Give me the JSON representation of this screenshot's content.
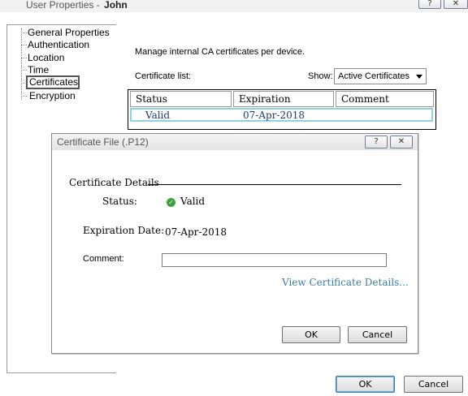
{
  "window": {
    "title_prefix": "User Properties -",
    "title_user": "John",
    "help_button": "?",
    "close_button": "✕"
  },
  "sidebar": {
    "items": [
      {
        "label": "General Properties"
      },
      {
        "label": "Authentication"
      },
      {
        "label": "Location"
      },
      {
        "label": "Time"
      },
      {
        "label": "Certificates",
        "selected": true
      },
      {
        "label": "Encryption"
      }
    ]
  },
  "certificates": {
    "description": "Manage internal CA certificates per device.",
    "list_label": "Certificate list:",
    "show_label": "Show:",
    "show_selected": "Active Certificates",
    "table": {
      "headers": [
        "Status",
        "Expiration",
        "Comment"
      ],
      "rows": [
        {
          "status": "Valid",
          "expiration": "07-Apr-2018",
          "comment": ""
        }
      ]
    }
  },
  "dialog": {
    "title": "Certificate File (.P12)",
    "help_button": "?",
    "close_button": "✕",
    "section_title": "Certificate Details",
    "status_label": "Status:",
    "status_value": "Valid",
    "status_icon": "check-circle-icon",
    "status_color": "#3aa23a",
    "expiration_label": "Expiration Date:",
    "expiration_value": "07-Apr-2018",
    "comment_label": "Comment:",
    "comment_value": "",
    "view_details_link": "View Certificate Details...",
    "ok_label": "OK",
    "cancel_label": "Cancel"
  },
  "footer": {
    "ok_label": "OK",
    "cancel_label": "Cancel"
  }
}
